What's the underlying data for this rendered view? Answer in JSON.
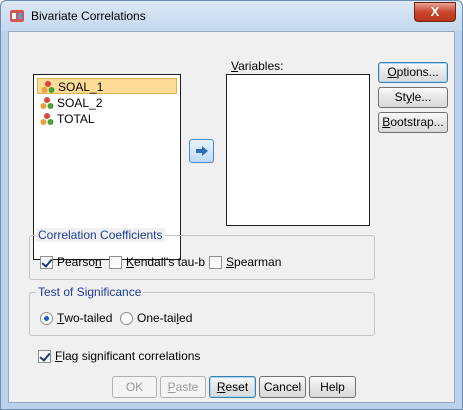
{
  "window": {
    "title": "Bivariate Correlations",
    "close_glyph": "X"
  },
  "source_list": {
    "items": [
      {
        "label": "SOAL_1",
        "icon": "scale-variable-icon",
        "selected": true
      },
      {
        "label": "SOAL_2",
        "icon": "scale-variable-icon",
        "selected": false
      },
      {
        "label": "TOTAL",
        "icon": "scale-variable-icon",
        "selected": false
      }
    ]
  },
  "variables": {
    "label_pre": "",
    "label_u": "V",
    "label_post": "ariables:"
  },
  "move_button": {
    "icon": "right-arrow-icon"
  },
  "side_buttons": {
    "options": {
      "pre": "",
      "u": "O",
      "post": "ptions..."
    },
    "style": {
      "pre": "St",
      "u": "y",
      "post": "le..."
    },
    "bootstrap": {
      "pre": "",
      "u": "B",
      "post": "ootstrap..."
    }
  },
  "coefficients": {
    "title": "Correlation Coefficients",
    "pearson": {
      "pre": "Pearso",
      "u": "n",
      "post": "",
      "checked": true
    },
    "kendall": {
      "pre": "",
      "u": "K",
      "post": "endall's tau-b",
      "checked": false
    },
    "spearman": {
      "pre": "",
      "u": "S",
      "post": "pearman",
      "checked": false
    }
  },
  "significance": {
    "title": "Test of Significance",
    "two_tailed": {
      "pre": "",
      "u": "T",
      "post": "wo-tailed",
      "selected": true
    },
    "one_tailed": {
      "pre": "One-tai",
      "u": "l",
      "post": "ed",
      "selected": false
    }
  },
  "flag": {
    "pre": "",
    "u": "F",
    "post": "lag significant correlations",
    "checked": true
  },
  "bottom_buttons": {
    "ok": "OK",
    "paste": {
      "pre": "",
      "u": "P",
      "post": "aste"
    },
    "reset": {
      "pre": "",
      "u": "R",
      "post": "eset"
    },
    "cancel": "Cancel",
    "help": "Help"
  },
  "colors": {
    "accent": "#1f3d9a",
    "selection": "#fcdc96",
    "titlebar": "#c4d8ee"
  }
}
